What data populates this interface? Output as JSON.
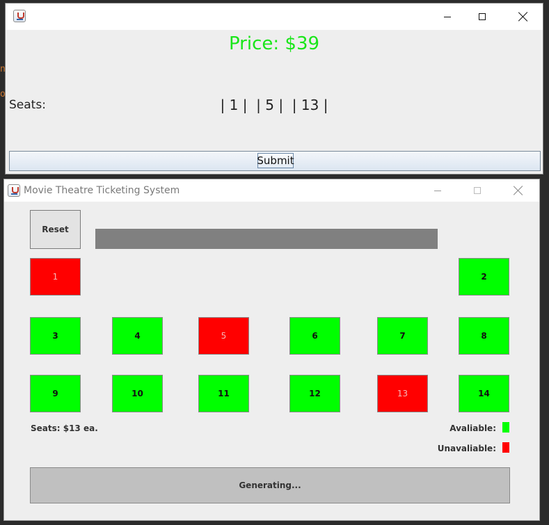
{
  "ticket_window": {
    "price_text": "Price: $39",
    "seats_label": "Seats:",
    "seats_list": "| 1 |  | 5 |  | 13 |",
    "submit_label": "Submit"
  },
  "main_window": {
    "title": "Movie Theatre Ticketing System",
    "reset_label": "Reset",
    "seats": [
      {
        "number": "1",
        "status": "unavailable"
      },
      {
        "number": "2",
        "status": "available"
      },
      {
        "number": "3",
        "status": "available"
      },
      {
        "number": "4",
        "status": "available"
      },
      {
        "number": "5",
        "status": "unavailable"
      },
      {
        "number": "6",
        "status": "available"
      },
      {
        "number": "7",
        "status": "available"
      },
      {
        "number": "8",
        "status": "available"
      },
      {
        "number": "9",
        "status": "available"
      },
      {
        "number": "10",
        "status": "available"
      },
      {
        "number": "11",
        "status": "available"
      },
      {
        "number": "12",
        "status": "available"
      },
      {
        "number": "13",
        "status": "unavailable"
      },
      {
        "number": "14",
        "status": "available"
      }
    ],
    "price_note": "Seats: $13 ea.",
    "legend": {
      "available_label": "Avaliable:",
      "unavailable_label": "Unavaliable:"
    },
    "generate_label": "Generating..."
  },
  "colors": {
    "available": "#00ff00",
    "unavailable": "#ff0000",
    "price_text": "#19e619",
    "screen": "#808080"
  }
}
